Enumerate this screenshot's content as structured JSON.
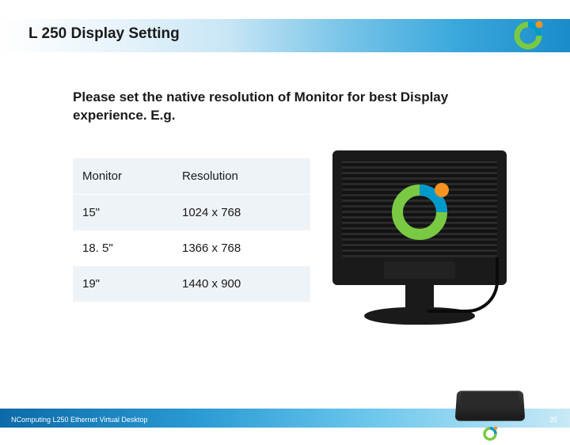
{
  "title": "L 250 Display Setting",
  "instruction": "Please set the native resolution of Monitor for best Display experience. E.g.",
  "table": {
    "headers": {
      "monitor": "Monitor",
      "resolution": "Resolution"
    },
    "rows": [
      {
        "monitor": "15\"",
        "resolution": "1024 x 768"
      },
      {
        "monitor": "18. 5\"",
        "resolution": "1366 x 768"
      },
      {
        "monitor": "19\"",
        "resolution": "1440 x 900"
      }
    ]
  },
  "footer": {
    "text": "NComputing L250 Ethernet Virtual Desktop",
    "page": "35"
  },
  "logo": {
    "brand": "NComputing"
  }
}
